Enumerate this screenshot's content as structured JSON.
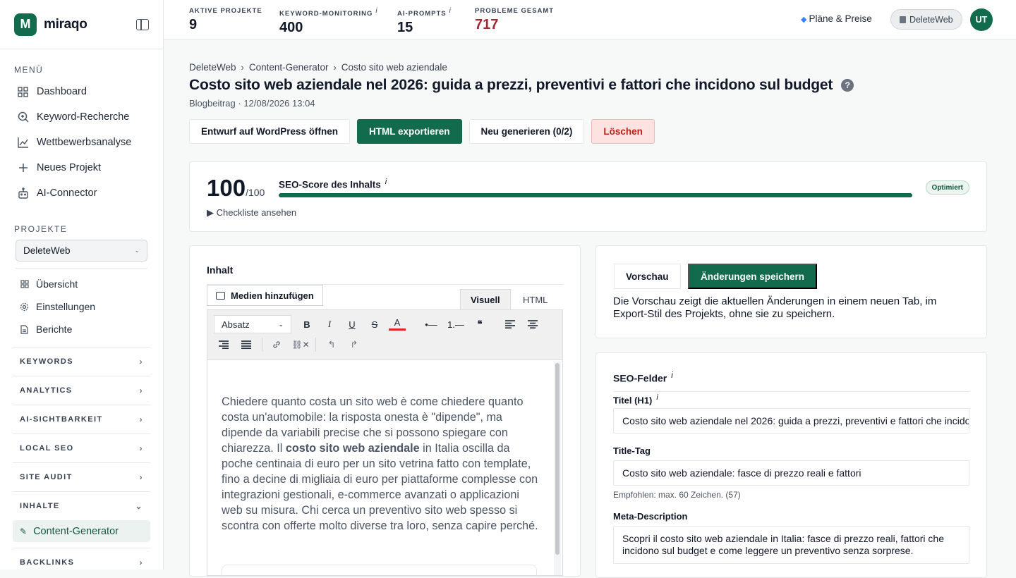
{
  "brand": {
    "logo_letter": "M",
    "name": "miraqo"
  },
  "sidebar": {
    "menu_label": "MENÜ",
    "nav": [
      {
        "label": "Dashboard",
        "icon": "grid-icon"
      },
      {
        "label": "Keyword-Recherche",
        "icon": "search-icon"
      },
      {
        "label": "Wettbewerbsanalyse",
        "icon": "chart-line-icon"
      },
      {
        "label": "Neues Projekt",
        "icon": "plus-icon"
      },
      {
        "label": "AI-Connector",
        "icon": "robot-icon"
      }
    ],
    "projects_label": "PROJEKTE",
    "project_selected": "DeleteWeb",
    "project_items": [
      {
        "label": "Übersicht",
        "icon": "grid-icon"
      },
      {
        "label": "Einstellungen",
        "icon": "gear-icon"
      },
      {
        "label": "Berichte",
        "icon": "document-icon"
      }
    ],
    "groups": [
      "KEYWORDS",
      "ANALYTICS",
      "AI-SICHTBARKEIT",
      "LOCAL SEO",
      "SITE AUDIT",
      "INHALTE",
      "BACKLINKS"
    ],
    "active_item": "Content-Generator"
  },
  "topbar": {
    "stats": [
      {
        "label": "AKTIVE PROJEKTE",
        "value": "9",
        "info": ""
      },
      {
        "label": "KEYWORD-MONITORING",
        "value": "400",
        "info": "i"
      },
      {
        "label": "AI-PROMPTS",
        "value": "15",
        "info": "i"
      },
      {
        "label": "PROBLEME GESAMT",
        "value": "717",
        "info": ""
      }
    ],
    "plans": "Pläne & Preise",
    "project": "DeleteWeb",
    "avatar": "UT"
  },
  "breadcrumb": [
    "DeleteWeb",
    "Content-Generator",
    "Costo sito web aziendale"
  ],
  "page": {
    "title": "Costo sito web aziendale nel 2026: guida a prezzi, preventivi e fattori che incidono sul budget",
    "help": "?",
    "subtitle": "Blogbeitrag · 12/08/2026 13:04"
  },
  "actions": {
    "open_wp": "Entwurf auf WordPress öffnen",
    "export_html": "HTML exportieren",
    "regenerate": "Neu generieren (0/2)",
    "delete": "Löschen"
  },
  "score": {
    "value": "100",
    "max": "/100",
    "label": "SEO-Score des Inhalts",
    "info": "i",
    "percent": 100,
    "badge": "Optimiert",
    "checklist": "▶ Checkliste ansehen"
  },
  "editor": {
    "heading": "Inhalt",
    "media_button": "Medien hinzufügen",
    "tabs": [
      "Visuell",
      "HTML"
    ],
    "format": "Absatz",
    "text_before": "Chiedere quanto costa un sito web è come chiedere quanto costa un'automobile: la risposta onesta è \"dipende\", ma dipende da variabili precise che si possono spiegare con chiarezza. Il ",
    "text_bold": "costo sito web aziendale",
    "text_after": " in Italia oscilla da poche centinaia di euro per un sito vetrina fatto con template, fino a decine di migliaia di euro per piattaforme complesse con integrazioni gestionali, e-commerce avanzati o applicazioni web su misura. Chi cerca un preventivo sito web spesso si scontra con offerte molto diverse tra loro, senza capire perché."
  },
  "preview": {
    "preview_button": "Vorschau",
    "save_button": "Änderungen speichern",
    "note": "Die Vorschau zeigt die aktuellen Änderungen in einem neuen Tab, im Export-Stil des Projekts, ohne sie zu speichern."
  },
  "seo": {
    "heading": "SEO-Felder",
    "info": "i",
    "h1_label": "Titel (H1)",
    "h1_value": "Costo sito web aziendale nel 2026: guida a prezzi, preventivi e fattori che incidono sul budget",
    "title_label": "Title-Tag",
    "title_value": "Costo sito web aziendale: fasce di prezzo reali e fattori",
    "title_hint": "Empfohlen: max. 60 Zeichen. (57)",
    "meta_label": "Meta-Description",
    "meta_value": "Scopri il costo sito web aziendale in Italia: fasce di prezzo reali, fattori che incidono sul budget e come leggere un preventivo senza sorprese."
  },
  "colors": {
    "accent": "#116b4c",
    "danger": "#b42318",
    "problems": "#a3282f"
  }
}
